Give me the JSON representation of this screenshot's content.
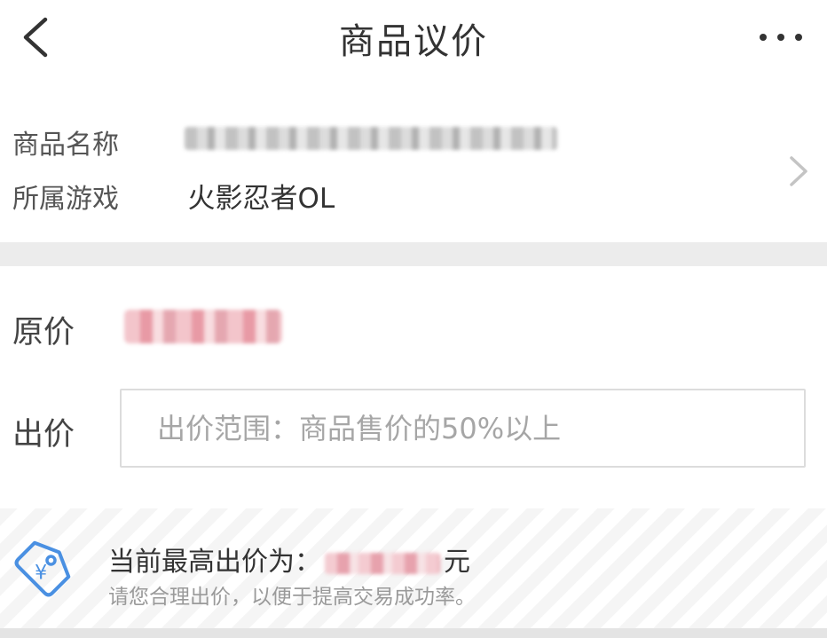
{
  "header": {
    "title": "商品议价",
    "back_icon": "chevron-left-icon",
    "more_icon": "more-horizontal-icon"
  },
  "product": {
    "name_label": "商品名称",
    "name_value": "",
    "game_label": "所属游戏",
    "game_value": "火影忍者OL"
  },
  "price": {
    "original_label": "原价",
    "offer_label": "出价",
    "offer_placeholder": "出价范围：商品售价的50%以上",
    "offer_value": ""
  },
  "tip": {
    "icon": "price-tag-icon",
    "highest_prefix": "当前最高出价为：",
    "highest_suffix": "元",
    "hint": "请您合理出价，以便于提高交易成功率。"
  },
  "colors": {
    "accent_blue": "#4a90e2",
    "text_primary": "#333333",
    "text_hint": "#9a9a9a",
    "divider": "#ececec",
    "border": "#dcdcdc"
  }
}
